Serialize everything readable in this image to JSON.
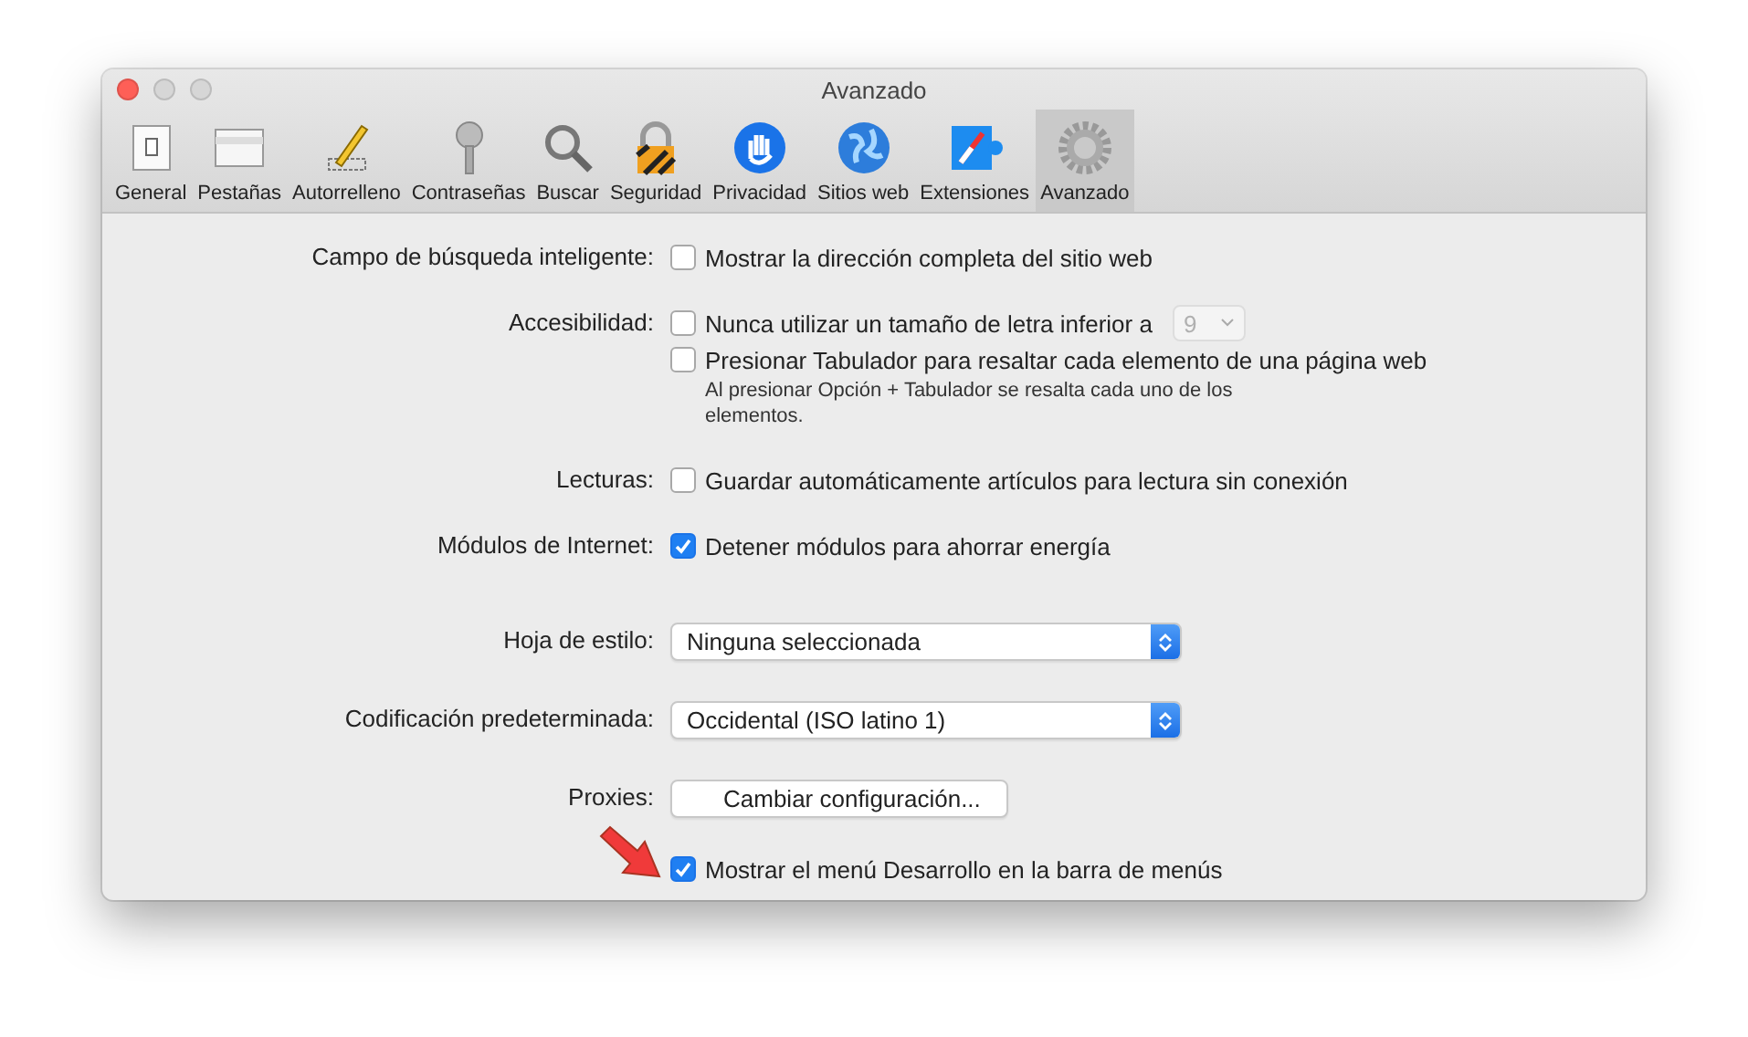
{
  "window": {
    "title": "Avanzado"
  },
  "toolbar": [
    {
      "label": "General",
      "selected": false
    },
    {
      "label": "Pestañas",
      "selected": false
    },
    {
      "label": "Autorrelleno",
      "selected": false
    },
    {
      "label": "Contraseñas",
      "selected": false
    },
    {
      "label": "Buscar",
      "selected": false
    },
    {
      "label": "Seguridad",
      "selected": false
    },
    {
      "label": "Privacidad",
      "selected": false
    },
    {
      "label": "Sitios web",
      "selected": false
    },
    {
      "label": "Extensiones",
      "selected": false
    },
    {
      "label": "Avanzado",
      "selected": true
    }
  ],
  "settings": [
    {
      "label": "Campo de búsqueda inteligente:",
      "items": [
        {
          "kind": "checkbox",
          "text": "Mostrar la dirección completa del sitio web",
          "checked": false
        }
      ]
    },
    {
      "label": "Accesibilidad:",
      "items": [
        {
          "kind": "checkbox",
          "text": "Nunca utilizar un tamaño de letra inferior a",
          "checked": false,
          "size_popup": {
            "value": "9",
            "disabled": true
          }
        },
        {
          "kind": "checkbox",
          "text": "Presionar Tabulador para resaltar cada elemento de una página web",
          "checked": false
        },
        {
          "kind": "note",
          "text": "Al presionar Opción + Tabulador se resalta cada uno de los elementos."
        }
      ]
    },
    {
      "label": "Lecturas:",
      "items": [
        {
          "kind": "checkbox",
          "text": "Guardar automáticamente artículos para lectura sin conexión",
          "checked": false
        }
      ]
    },
    {
      "label": "Módulos de Internet:",
      "items": [
        {
          "kind": "checkbox",
          "text": "Detener módulos para ahorrar energía",
          "checked": true
        }
      ]
    },
    {
      "label": "Hoja de estilo:",
      "items": [
        {
          "kind": "popup",
          "value": "Ninguna seleccionada"
        }
      ]
    },
    {
      "label": "Codificación predeterminada:",
      "items": [
        {
          "kind": "popup",
          "value": "Occidental (ISO latino 1)"
        }
      ]
    },
    {
      "label": "Proxies:",
      "items": [
        {
          "kind": "button",
          "text": "Cambiar configuración..."
        }
      ]
    },
    {
      "items": [
        {
          "kind": "checkbox",
          "text": "Mostrar el menú Desarrollo en la barra de menús",
          "checked": true,
          "annotated": true
        }
      ]
    }
  ]
}
